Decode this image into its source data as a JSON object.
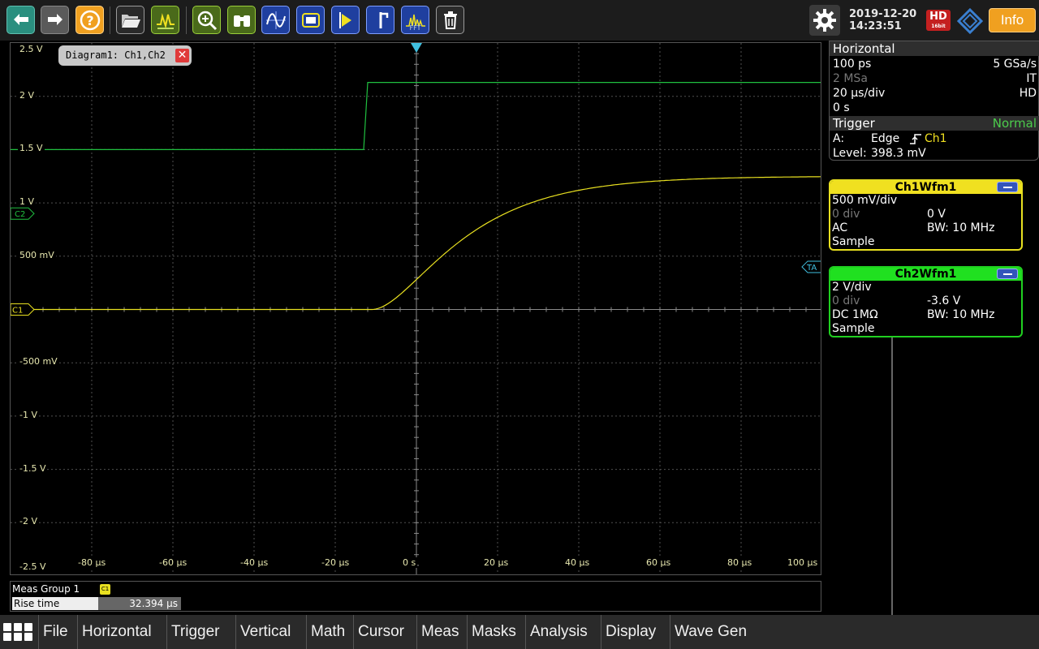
{
  "toolbar": {
    "icons": [
      "undo-icon",
      "redo-icon",
      "help-icon",
      "open-folder-icon",
      "autoset-icon",
      "zoom-icon",
      "find-icon",
      "waveform-icon",
      "mask-icon",
      "cursor-icon",
      "marker-icon",
      "fft-icon",
      "delete-icon"
    ],
    "fft_label": "FFT",
    "settings_icon": "gear-icon"
  },
  "status": {
    "date": "2019-12-20",
    "time": "14:23:51",
    "hd_label": "HD",
    "hd_sub": "16bit",
    "info_label": "Info"
  },
  "diagram": {
    "tab_label": "Diagram1: Ch1,Ch2",
    "y_labels": [
      "2.5 V",
      "2 V",
      "1.5 V",
      "1 V",
      "500 mV",
      "",
      "-500 mV",
      "-1 V",
      "-1.5 V",
      "-2 V",
      "-2.5 V"
    ],
    "x_labels": [
      "-80 µs",
      "-60 µs",
      "-40 µs",
      "-20 µs",
      "0 s",
      "20 µs",
      "40 µs",
      "60 µs",
      "80 µs",
      "100 µs"
    ],
    "ch2_marker": "C2",
    "ch1_marker": "C1",
    "trigger_marker": "TA",
    "colors": {
      "ch1": "#e8e020",
      "ch2": "#20c040",
      "grid": "#505050"
    }
  },
  "horizontal": {
    "title": "Horizontal",
    "resolution": "100 ps",
    "sample_rate": "5 GSa/s",
    "record_length": "2 MSa",
    "mode": "IT",
    "time_scale": "20 µs/div",
    "hd_flag": "HD",
    "position": "0 s"
  },
  "trigger": {
    "title": "Trigger",
    "mode": "Normal",
    "source_prefix": "A:",
    "type": "Edge",
    "channel": "Ch1",
    "level_label": "Level:",
    "level": "398.3 mV"
  },
  "ch1wfm": {
    "title": "Ch1Wfm1",
    "scale": "500 mV/div",
    "position": "0 div",
    "offset": "0 V",
    "coupling": "AC",
    "bandwidth": "BW: 10 MHz",
    "acq": "Sample",
    "color": "#f0e020"
  },
  "ch2wfm": {
    "title": "Ch2Wfm1",
    "scale": "2 V/div",
    "position": "0 div",
    "offset": "-3.6 V",
    "coupling": "DC 1MΩ",
    "bandwidth": "BW: 10 MHz",
    "acq": "Sample",
    "color": "#20e020"
  },
  "meas": {
    "group": "Meas Group 1",
    "badge": "C1",
    "name": "Rise time",
    "value": "32.394 µs"
  },
  "menu": [
    "File",
    "Horizontal",
    "Trigger",
    "Vertical",
    "Math",
    "Cursor",
    "Meas",
    "Masks",
    "Analysis",
    "Display",
    "Wave Gen"
  ]
}
